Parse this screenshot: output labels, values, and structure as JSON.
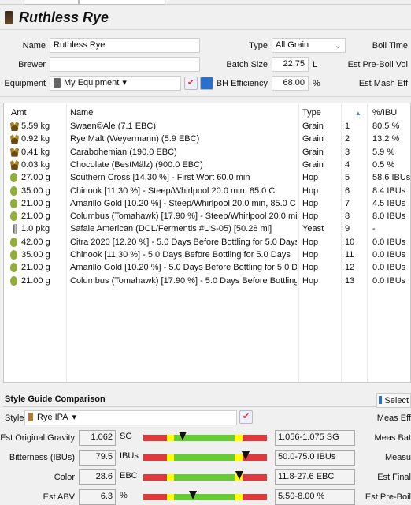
{
  "recipe": {
    "title": "Ruthless Rye"
  },
  "form": {
    "name_label": "Name",
    "name_value": "Ruthless Rye",
    "brewer_label": "Brewer",
    "brewer_value": "",
    "equipment_label": "Equipment",
    "equipment_value": "My Equipment",
    "type_label": "Type",
    "type_value": "All Grain",
    "batch_label": "Batch Size",
    "batch_value": "22.75",
    "batch_unit": "L",
    "eff_label": "BH Efficiency",
    "eff_value": "68.00",
    "eff_unit": "%",
    "boil_time_label": "Boil Time",
    "preboil_label": "Est Pre-Boil Vol",
    "mash_eff_label": "Est Mash Eff"
  },
  "ingredients": {
    "headers": {
      "amt": "Amt",
      "name": "Name",
      "type": "Type",
      "num": "",
      "pct": "%/IBU"
    },
    "rows": [
      {
        "icon": "grain",
        "amt": "5.59 kg",
        "name": "Swaen©Ale (7.1 EBC)",
        "type": "Grain",
        "n": "1",
        "v": "80.5 %"
      },
      {
        "icon": "grain",
        "amt": "0.92 kg",
        "name": "Rye Malt (Weyermann) (5.9 EBC)",
        "type": "Grain",
        "n": "2",
        "v": "13.2 %"
      },
      {
        "icon": "grain",
        "amt": "0.41 kg",
        "name": "Carabohemian (190.0 EBC)",
        "type": "Grain",
        "n": "3",
        "v": "5.9 %"
      },
      {
        "icon": "grain",
        "amt": "0.03 kg",
        "name": "Chocolate (BestMälz) (900.0 EBC)",
        "type": "Grain",
        "n": "4",
        "v": "0.5 %"
      },
      {
        "icon": "hop",
        "amt": "27.00 g",
        "name": "Southern Cross [14.30 %] - First Wort 60.0 min",
        "type": "Hop",
        "n": "5",
        "v": "58.6 IBUs"
      },
      {
        "icon": "hop",
        "amt": "35.00 g",
        "name": "Chinook [11.30 %] - Steep/Whirlpool  20.0 min, 85.0 C",
        "type": "Hop",
        "n": "6",
        "v": "8.4 IBUs"
      },
      {
        "icon": "hop",
        "amt": "21.00 g",
        "name": "Amarillo Gold [10.20 %] - Steep/Whirlpool  20.0 min, 85.0 C",
        "type": "Hop",
        "n": "7",
        "v": "4.5 IBUs"
      },
      {
        "icon": "hop",
        "amt": "21.00 g",
        "name": "Columbus (Tomahawk) [17.90 %] - Steep/Whirlpool  20.0 mi...",
        "type": "Hop",
        "n": "8",
        "v": "8.0 IBUs"
      },
      {
        "icon": "yeast",
        "amt": "1.0 pkg",
        "name": "Safale American  (DCL/Fermentis #US-05) [50.28 ml]",
        "type": "Yeast",
        "n": "9",
        "v": "-"
      },
      {
        "icon": "hop",
        "amt": "42.00 g",
        "name": "Citra 2020 [12.20 %] - 5.0 Days Before Bottling for 5.0 Days",
        "type": "Hop",
        "n": "10",
        "v": "0.0 IBUs"
      },
      {
        "icon": "hop",
        "amt": "35.00 g",
        "name": "Chinook [11.30 %] - 5.0 Days Before Bottling for 5.0 Days",
        "type": "Hop",
        "n": "11",
        "v": "0.0 IBUs"
      },
      {
        "icon": "hop",
        "amt": "21.00 g",
        "name": "Amarillo Gold [10.20 %] - 5.0 Days Before Bottling for 5.0 Days",
        "type": "Hop",
        "n": "12",
        "v": "0.0 IBUs"
      },
      {
        "icon": "hop",
        "amt": "21.00 g",
        "name": "Columbus (Tomahawk) [17.90 %] - 5.0 Days Before Bottling f...",
        "type": "Hop",
        "n": "13",
        "v": "0.0 IBUs"
      }
    ]
  },
  "style_guide": {
    "title": "Style Guide Comparison",
    "style_label": "Style",
    "style_value": "Rye IPA",
    "select_label": "Select",
    "right_labels": [
      "Meas Eff",
      "Meas Bat",
      "Measu",
      "Est Final",
      "Est Pre-Boil"
    ],
    "rows": [
      {
        "label": "Est Original Gravity",
        "value": "1.062",
        "unit": "SG",
        "range": "1.056-1.075 SG",
        "marker_pct": 32
      },
      {
        "label": "Bitterness (IBUs)",
        "value": "79.5",
        "unit": "IBUs",
        "range": "50.0-75.0 IBUs",
        "marker_pct": 83
      },
      {
        "label": "Color",
        "value": "28.6",
        "unit": "EBC",
        "range": "11.8-27.6 EBC",
        "marker_pct": 78
      },
      {
        "label": "Est ABV",
        "value": "6.3",
        "unit": "%",
        "range": "5.50-8.00 %",
        "marker_pct": 40
      }
    ],
    "colors": {
      "red": "#e0393b",
      "yellow": "#ffff00",
      "green": "#66cc33"
    }
  }
}
